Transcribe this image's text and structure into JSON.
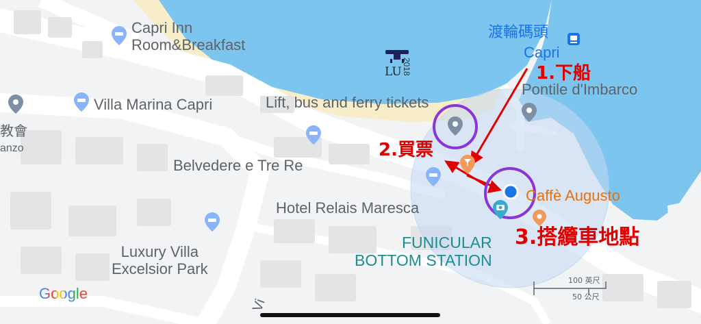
{
  "map": {
    "colors": {
      "water": "#7bc5ef",
      "land": "#f1f3f4",
      "road": "#ffffff",
      "beach": "#f7eec9",
      "building": "#e3e4e6",
      "poi_pin": "#7e8fa3",
      "hotel_pin": "#8ab4f8",
      "accuracy_circle": "#c6d9f5",
      "user_dot": "#1a73e8",
      "highlight_ring": "#8a35d6",
      "arrow": "#e00000"
    },
    "labels": {
      "capri_inn": "Capri Inn\nRoom&Breakfast",
      "villa_marina": "Villa Marina Capri",
      "ferry_pier_zh": "渡輪碼頭",
      "capri": "Capri",
      "pontile": "Pontile d'Imbarco",
      "lift_tickets": "Lift, bus and ferry tickets",
      "belvedere": "Belvedere e Tre Re",
      "hotel_relais": "Hotel Relais Maresca",
      "caffe_augusto": "Caffè Augusto",
      "luxury_villa": "Luxury Villa\nExcelsior Park",
      "funicular": "FUNICULAR\nBOTTOM STATION",
      "left_partial_church": "教會",
      "left_partial_anzo": "anzo",
      "bottom_partial": "Vi"
    },
    "annotations": {
      "step1": "1.下船",
      "step2": "2.買票",
      "step3": "3.搭纜車地點"
    },
    "watermark": {
      "brand": "LU",
      "year": "2018"
    },
    "scale": {
      "feet": "100 英尺",
      "meters": "50 公尺"
    },
    "logo": "Google",
    "icons": {
      "hotel": "hotel-pin-icon",
      "poi": "poi-pin-icon",
      "transit": "ferry-transit-icon",
      "bar": "bar-cocktail-icon",
      "camera": "camera-pin-icon",
      "user": "user-location-dot-icon"
    }
  }
}
